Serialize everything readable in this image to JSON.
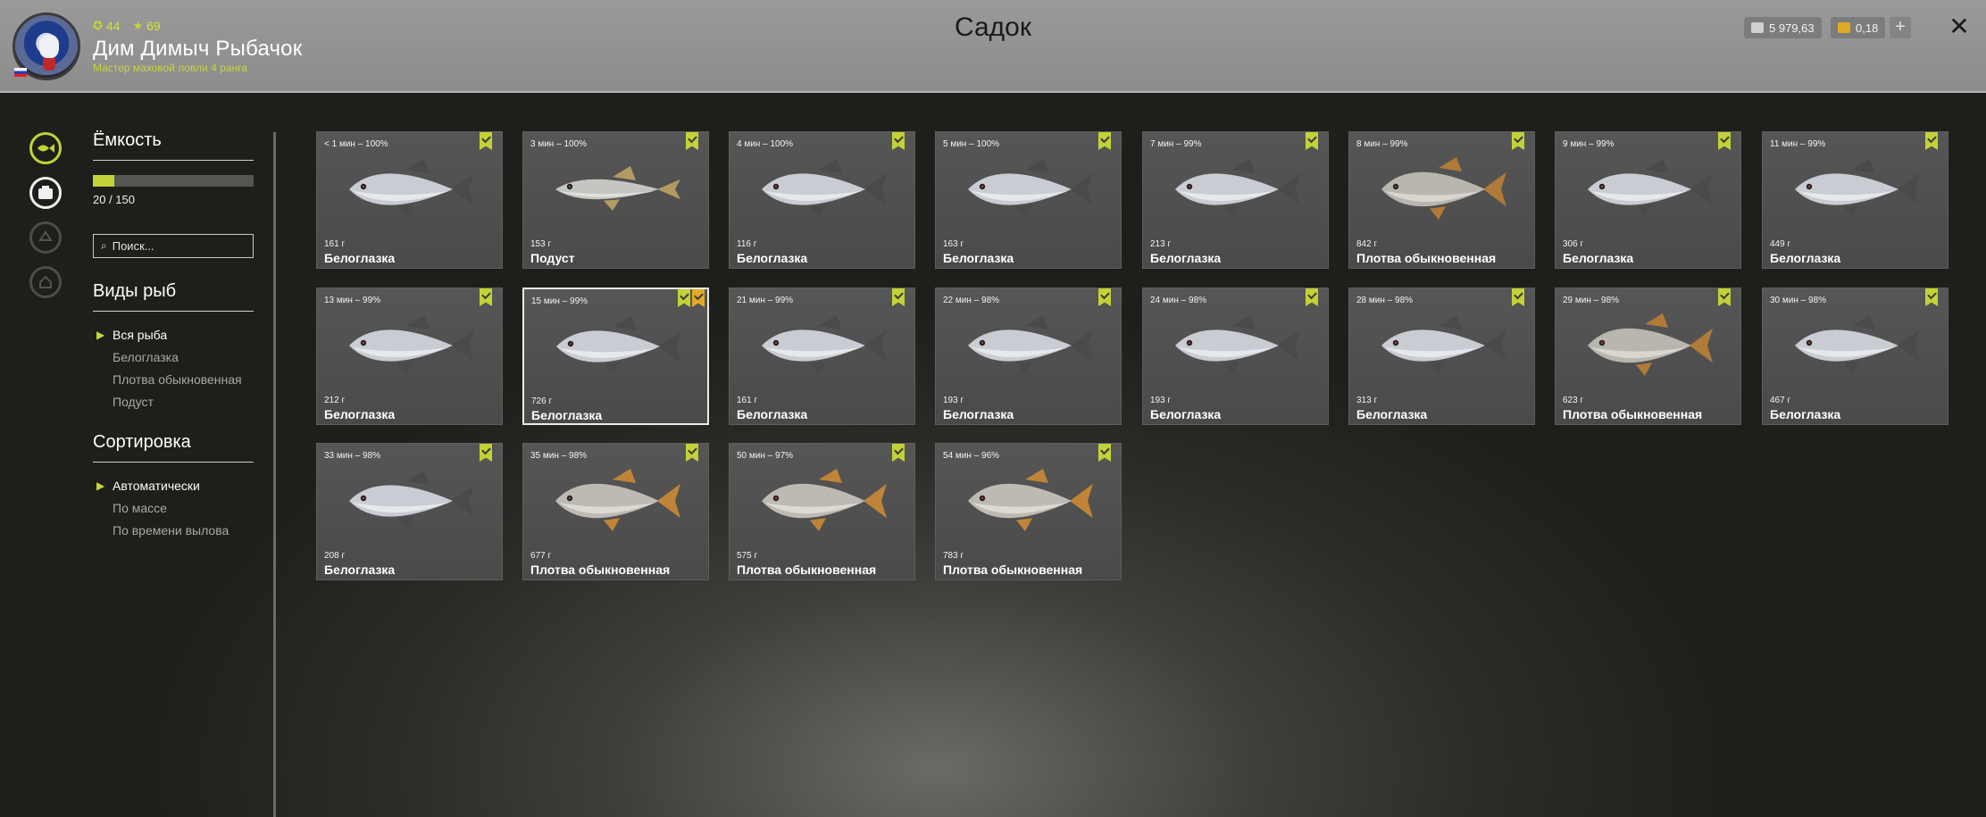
{
  "header": {
    "title": "Садок",
    "player": {
      "name": "Дим Димыч Рыбачок",
      "title": "Мастер маховой ловли 4 ранга",
      "stat_level": "44",
      "stat_rank": "69"
    },
    "currency": [
      {
        "icon": "silver-coin-icon",
        "value": "5 979,63",
        "color": "#d0d0d0"
      },
      {
        "icon": "gold-coin-icon",
        "value": "0,18",
        "color": "#e0aa28"
      }
    ]
  },
  "sidebar": {
    "capacity_title": "Ёмкость",
    "capacity_text": "20 / 150",
    "capacity_fraction": 0.133,
    "search_placeholder": "Поиск...",
    "species_title": "Виды рыб",
    "species": [
      {
        "label": "Вся рыба",
        "active": true
      },
      {
        "label": "Белоглазка",
        "active": false
      },
      {
        "label": "Плотва обыкновенная",
        "active": false
      },
      {
        "label": "Подуст",
        "active": false
      }
    ],
    "sort_title": "Сортировка",
    "sort": [
      {
        "label": "Автоматически",
        "active": true
      },
      {
        "label": "По массе",
        "active": false
      },
      {
        "label": "По времени вылова",
        "active": false
      }
    ]
  },
  "accent_color": "#c2d237",
  "fish": [
    {
      "time": "< 1 мин – 100%",
      "weight": "161 г",
      "name": "Белоглазка",
      "kind": "bream"
    },
    {
      "time": "3 мин – 100%",
      "weight": "153 г",
      "name": "Подуст",
      "kind": "podust"
    },
    {
      "time": "4 мин – 100%",
      "weight": "116 г",
      "name": "Белоглазка",
      "kind": "bream"
    },
    {
      "time": "5 мин – 100%",
      "weight": "163 г",
      "name": "Белоглазка",
      "kind": "bream"
    },
    {
      "time": "7 мин – 99%",
      "weight": "213 г",
      "name": "Белоглазка",
      "kind": "bream"
    },
    {
      "time": "8 мин – 99%",
      "weight": "842 г",
      "name": "Плотва обыкновенная",
      "kind": "roach"
    },
    {
      "time": "9 мин – 99%",
      "weight": "306 г",
      "name": "Белоглазка",
      "kind": "bream"
    },
    {
      "time": "11 мин – 99%",
      "weight": "449 г",
      "name": "Белоглазка",
      "kind": "bream"
    },
    {
      "time": "13 мин – 99%",
      "weight": "212 г",
      "name": "Белоглазка",
      "kind": "bream"
    },
    {
      "time": "15 мин – 99%",
      "weight": "726 г",
      "name": "Белоглазка",
      "kind": "bream",
      "selected": true,
      "star": true
    },
    {
      "time": "21 мин – 99%",
      "weight": "161 г",
      "name": "Белоглазка",
      "kind": "bream"
    },
    {
      "time": "22 мин – 98%",
      "weight": "193 г",
      "name": "Белоглазка",
      "kind": "bream"
    },
    {
      "time": "24 мин – 98%",
      "weight": "193 г",
      "name": "Белоглазка",
      "kind": "bream"
    },
    {
      "time": "28 мин – 98%",
      "weight": "313 г",
      "name": "Белоглазка",
      "kind": "bream"
    },
    {
      "time": "29 мин – 98%",
      "weight": "623 г",
      "name": "Плотва обыкновенная",
      "kind": "roach"
    },
    {
      "time": "30 мин – 98%",
      "weight": "467 г",
      "name": "Белоглазка",
      "kind": "bream"
    },
    {
      "time": "33 мин – 98%",
      "weight": "208 г",
      "name": "Белоглазка",
      "kind": "bream"
    },
    {
      "time": "35 мин – 98%",
      "weight": "677 г",
      "name": "Плотва обыкновенная",
      "kind": "roach2"
    },
    {
      "time": "50 мин – 97%",
      "weight": "575 г",
      "name": "Плотва обыкновенная",
      "kind": "roach2"
    },
    {
      "time": "54 мин – 96%",
      "weight": "783 г",
      "name": "Плотва обыкновенная",
      "kind": "roach2"
    }
  ]
}
